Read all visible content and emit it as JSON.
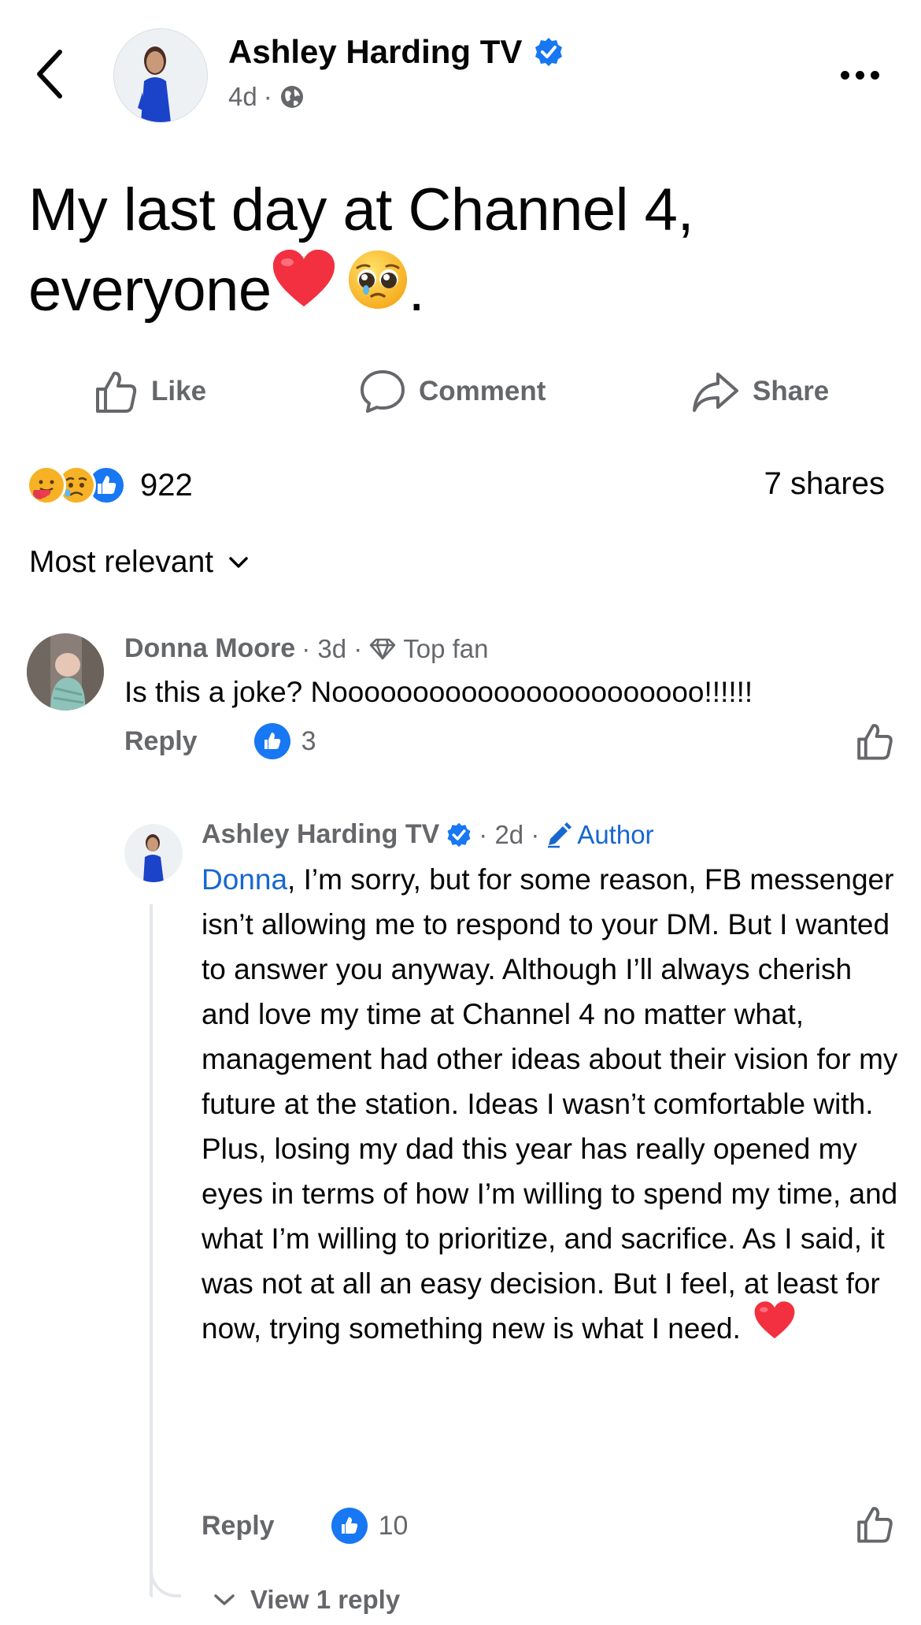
{
  "header": {
    "page_name": "Ashley Harding TV",
    "time": "4d",
    "separator": "·",
    "privacy_icon": "globe-icon",
    "back_icon": "chevron-left-icon",
    "more_icon": "more-dots-icon"
  },
  "post": {
    "line1": "My last day at Channel 4,",
    "line2": "everyone",
    "end": "."
  },
  "actions": {
    "like": "Like",
    "comment": "Comment",
    "share": "Share"
  },
  "stats": {
    "reaction_count": "922",
    "shares": "7 shares",
    "reaction_icons": [
      "care-reaction-icon",
      "sad-reaction-icon",
      "like-reaction-icon"
    ]
  },
  "sort": {
    "label": "Most relevant"
  },
  "comments": [
    {
      "name": "Donna Moore",
      "meta": "· 3d ·",
      "badge": "Top fan",
      "text": "Is this a joke? Nooooooooooooooooooooooo!!!!!!",
      "reply_label": "Reply",
      "like_count": "3"
    },
    {
      "name": "Ashley Harding TV",
      "meta": "· 2d ·",
      "badge": "Author",
      "mention": "Donna",
      "text": ", I’m sorry, but for some reason, FB messenger isn’t allowing me to respond to your DM. But I wanted to answer you anyway. Although I’ll always cherish and love my time at Channel 4 no matter what, management had other ideas about their vision for my future at the station. Ideas I wasn’t comfortable with. Plus, losing my dad this year has really opened my eyes in terms of how I’m willing to spend my time, and what I’m willing to prioritize, and sacrifice. As I said, it was not at all an easy decision. But I feel, at least for now, trying something new is what I need.",
      "reply_label": "Reply",
      "like_count": "10"
    }
  ],
  "view_reply": "View 1 reply",
  "colors": {
    "facebook_blue": "#1877f2",
    "secondary_text": "#65676b",
    "heart_red": "#e0245e"
  }
}
